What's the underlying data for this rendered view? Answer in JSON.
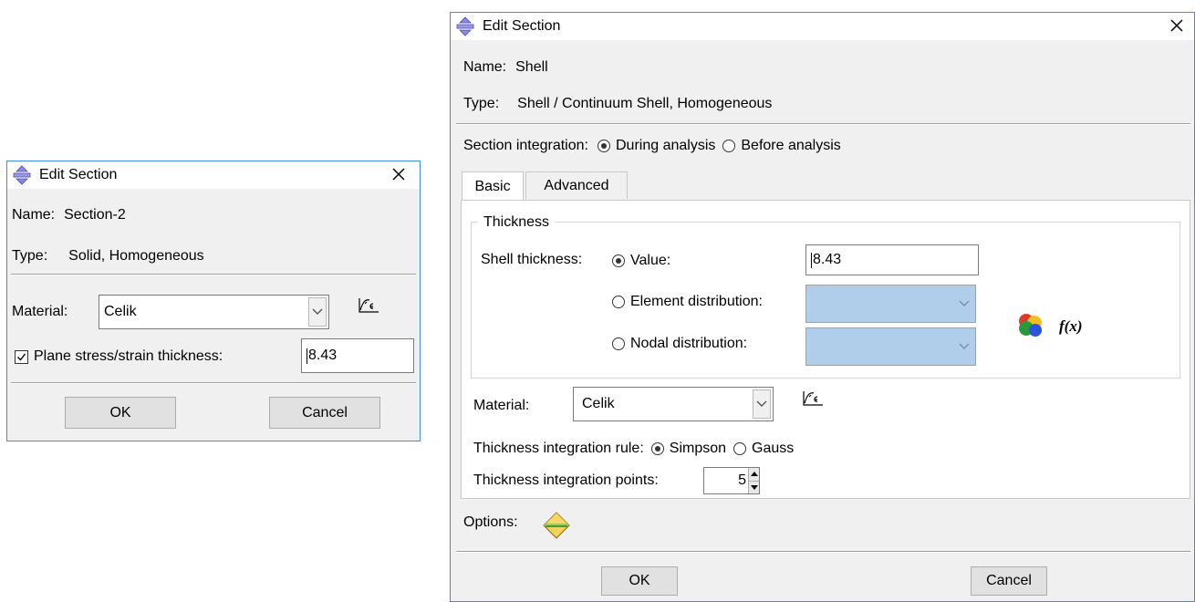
{
  "small": {
    "title": "Edit Section",
    "name_label": "Name:",
    "name_value": "Section-2",
    "type_label": "Type:",
    "type_value": "Solid, Homogeneous",
    "material_label": "Material:",
    "material_value": "Celik",
    "plane_label": "Plane stress/strain thickness:",
    "plane_checked": true,
    "thickness_value": "8.43",
    "ok_label": "OK",
    "cancel_label": "Cancel"
  },
  "large": {
    "title": "Edit Section",
    "name_label": "Name:",
    "name_value": "Shell",
    "type_label": "Type:",
    "type_value": "Shell / Continuum Shell, Homogeneous",
    "integration_label": "Section integration:",
    "integration_options": [
      "During analysis",
      "Before analysis"
    ],
    "integration_selected": "During analysis",
    "tabs": [
      {
        "label": "Basic",
        "active": true
      },
      {
        "label": "Advanced",
        "active": false
      }
    ],
    "thickness_group": "Thickness",
    "shell_thickness_label": "Shell thickness:",
    "thickness_options": [
      "Value:",
      "Element distribution:",
      "Nodal distribution:"
    ],
    "thickness_selected": "Value:",
    "thickness_value": "8.43",
    "fx_label": "f(x)",
    "material_label": "Material:",
    "material_value": "Celik",
    "rule_label": "Thickness integration rule:",
    "rule_options": [
      "Simpson",
      "Gauss"
    ],
    "rule_selected": "Simpson",
    "points_label": "Thickness integration points:",
    "points_value": "5",
    "options_label": "Options:",
    "ok_label": "OK",
    "cancel_label": "Cancel"
  },
  "colors": {
    "dialog_border": "#3c8ee0",
    "dialog_bg": "#f0f0f0",
    "disabled_combo": "#b0cde9"
  },
  "icons": {
    "title": "edit-section-icon",
    "close": "close-icon",
    "material_manager": "material-manager-icon",
    "analytical_field": "analytical-field-icon",
    "options": "section-options-icon"
  }
}
